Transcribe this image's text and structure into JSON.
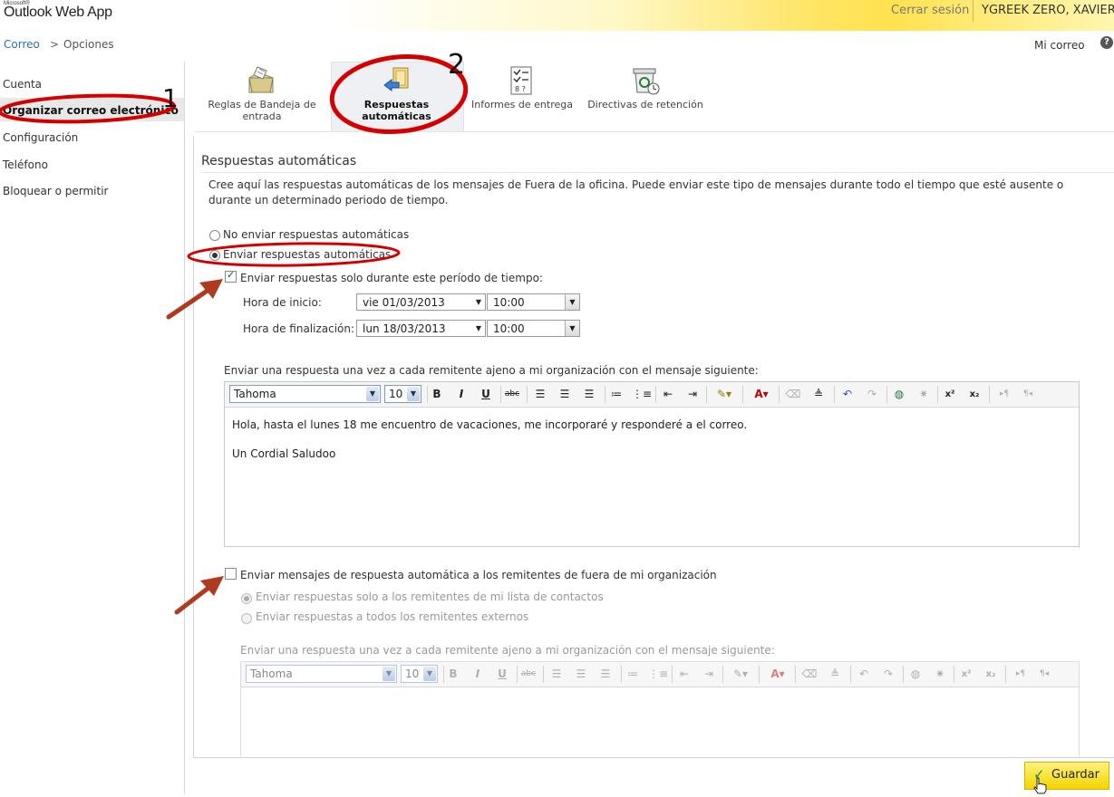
{
  "app": {
    "brand_small": "Microsoft®",
    "title": "Outlook Web App"
  },
  "header": {
    "sign_out": "Cerrar sesión",
    "user": "YGREEK ZERO, XAVIER",
    "my_mail": "Mi correo",
    "help_glyph": "?"
  },
  "breadcrumb": {
    "root": "Correo",
    "separator": ">",
    "current": "Opciones"
  },
  "sidebar": {
    "items": [
      {
        "label": "Cuenta"
      },
      {
        "label": "Organizar correo electrónico"
      },
      {
        "label": "Configuración"
      },
      {
        "label": "Teléfono"
      },
      {
        "label": "Bloquear o permitir"
      }
    ]
  },
  "tabs": [
    {
      "label": "Reglas de Bandeja de entrada",
      "icon": "inbox-rules-icon"
    },
    {
      "label": "Respuestas automáticas",
      "icon": "auto-reply-icon"
    },
    {
      "label": "Informes de entrega",
      "icon": "delivery-report-icon"
    },
    {
      "label": "Directivas de retención",
      "icon": "retention-policy-icon"
    }
  ],
  "section": {
    "title": "Respuestas automáticas",
    "description": "Cree aquí las respuestas automáticas de los mensajes de Fuera de la oficina. Puede enviar este tipo de mensajes durante todo el tiempo que esté ausente o durante un determinado periodo de tiempo."
  },
  "options": {
    "no_send": "No enviar respuestas automáticas",
    "send": "Enviar respuestas automáticas",
    "period_checkbox": "Enviar respuestas solo durante este período de tiempo:",
    "start_label": "Hora de inicio:",
    "start_date": "vie 01/03/2013",
    "start_time": "10:00",
    "end_label": "Hora de finalización:",
    "end_date": "lun 18/03/2013",
    "end_time": "10:00"
  },
  "internal_editor": {
    "label": "Enviar una respuesta una vez a cada remitente ajeno a mi organización con el mensaje siguiente:",
    "font": "Tahoma",
    "size": "10",
    "body_line1": "Hola, hasta el lunes 18 me encuentro de vacaciones, me incorporaré y responderé a el correo.",
    "body_line2": "Un Cordial Saludoo"
  },
  "external": {
    "checkbox": "Enviar mensajes de respuesta automática a los remitentes de fuera de mi organización",
    "contacts_only": "Enviar respuestas solo a los remitentes de mi lista de contactos",
    "all_external": "Enviar respuestas a todos los remitentes externos",
    "editor_label": "Enviar una respuesta una vez a cada remitente ajeno a mi organización con el mensaje siguiente:",
    "font": "Tahoma",
    "size": "10"
  },
  "toolbar_glyphs": {
    "bold": "B",
    "italic": "I",
    "underline": "U",
    "strike": "abc",
    "superscript": "x²",
    "subscript": "x₂"
  },
  "save": {
    "label": "Guardar"
  },
  "annotations": {
    "step1": "1",
    "step2": "2"
  },
  "colors": {
    "annotation_red": "#d40000",
    "arrow": "#b03a20",
    "save_bg": "#f7de1c",
    "link": "#2a6ebb"
  }
}
